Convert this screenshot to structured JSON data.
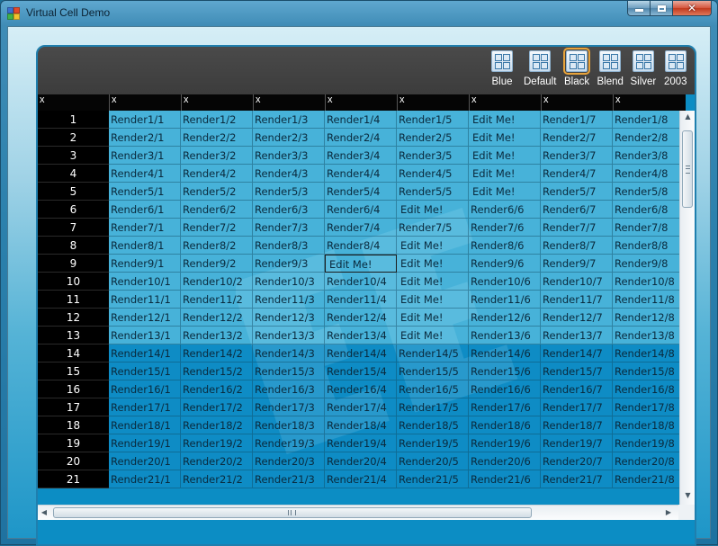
{
  "window": {
    "title": "Virtual Cell Demo",
    "minimize_label": "",
    "maximize_label": "",
    "close_label": "✕"
  },
  "toolbar": {
    "themes": [
      {
        "label": "Blue",
        "icon": "blue-theme-icon",
        "active": false
      },
      {
        "label": "Default",
        "icon": "default-theme-icon",
        "active": false
      },
      {
        "label": "Black",
        "icon": "black-theme-icon",
        "active": true
      },
      {
        "label": "Blend",
        "icon": "blend-theme-icon",
        "active": false
      },
      {
        "label": "Silver",
        "icon": "silver-theme-icon",
        "active": false
      },
      {
        "label": "2003",
        "icon": "office2003-theme-icon",
        "active": false
      }
    ]
  },
  "grid": {
    "headers": [
      "x",
      "x",
      "x",
      "x",
      "x",
      "x",
      "x",
      "x",
      "x"
    ],
    "render_prefix": "Render",
    "edit_text": "Edit Me!",
    "row_count": 22,
    "col_count": 8,
    "edit_cells": [
      [
        1,
        6
      ],
      [
        2,
        6
      ],
      [
        3,
        6
      ],
      [
        4,
        6
      ],
      [
        5,
        6
      ],
      [
        6,
        5
      ],
      [
        8,
        5
      ],
      [
        9,
        5
      ],
      [
        10,
        5
      ],
      [
        11,
        5
      ],
      [
        12,
        5
      ],
      [
        13,
        5
      ],
      [
        9,
        4
      ]
    ],
    "focused_cell": [
      9,
      4
    ],
    "dark_from_row": 14
  },
  "colors": {
    "header_bg": "#050505",
    "toolbar_bg": "#444444",
    "active_theme_outline": "#e8a33a",
    "row_header_bg": "#000000"
  }
}
